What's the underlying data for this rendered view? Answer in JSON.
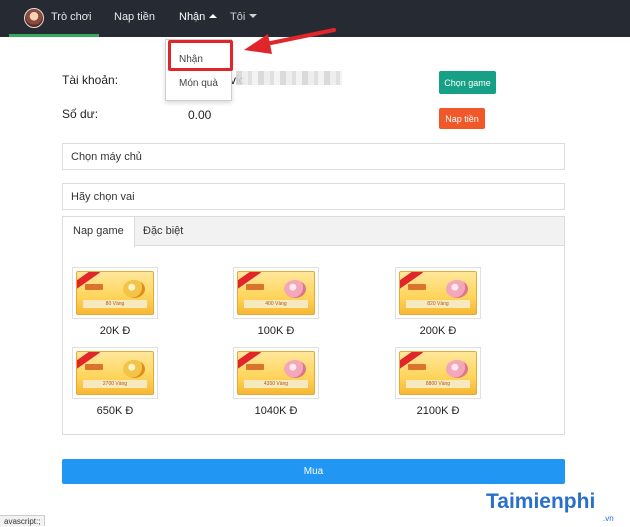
{
  "nav": {
    "home": "Trò chơi",
    "naptien": "Nap tiền",
    "nhan": "Nhận",
    "toi": "Tôi"
  },
  "dropdown": {
    "items": [
      "Nhận",
      "Món quà"
    ]
  },
  "form": {
    "account_label": "Tài khoản:",
    "account_value": "vic",
    "balance_label": "Số dư:",
    "balance_value": "0.00",
    "choose_game_label": "Chọn game",
    "topup_label": "Nap tiền",
    "server_placeholder": "Chọn máy chủ",
    "role_placeholder": "Hãy chọn vai"
  },
  "tabs": [
    "Nap game",
    "Đặc biệt"
  ],
  "packages": [
    {
      "amount": "80 Vàng",
      "price": "20K Đ",
      "style": "gold"
    },
    {
      "amount": "400 Vàng",
      "price": "100K Đ",
      "style": "pink"
    },
    {
      "amount": "820 Vàng",
      "price": "200K Đ",
      "style": "pink"
    },
    {
      "amount": "2700 Vàng",
      "price": "650K Đ",
      "style": "gold"
    },
    {
      "amount": "4350 Vàng",
      "price": "1040K Đ",
      "style": "pink"
    },
    {
      "amount": "8800 Vàng",
      "price": "2100K Đ",
      "style": "pink"
    }
  ],
  "buy_label": "Mua",
  "status_text": "avascript:;",
  "watermark": {
    "brand": "Taimienphi",
    "tld": ".vn"
  },
  "colors": {
    "topbar": "#262b33",
    "accent_green": "#16a085",
    "accent_orange": "#f0582a",
    "buy_blue": "#2196f3",
    "highlight_red": "#e0262a"
  }
}
